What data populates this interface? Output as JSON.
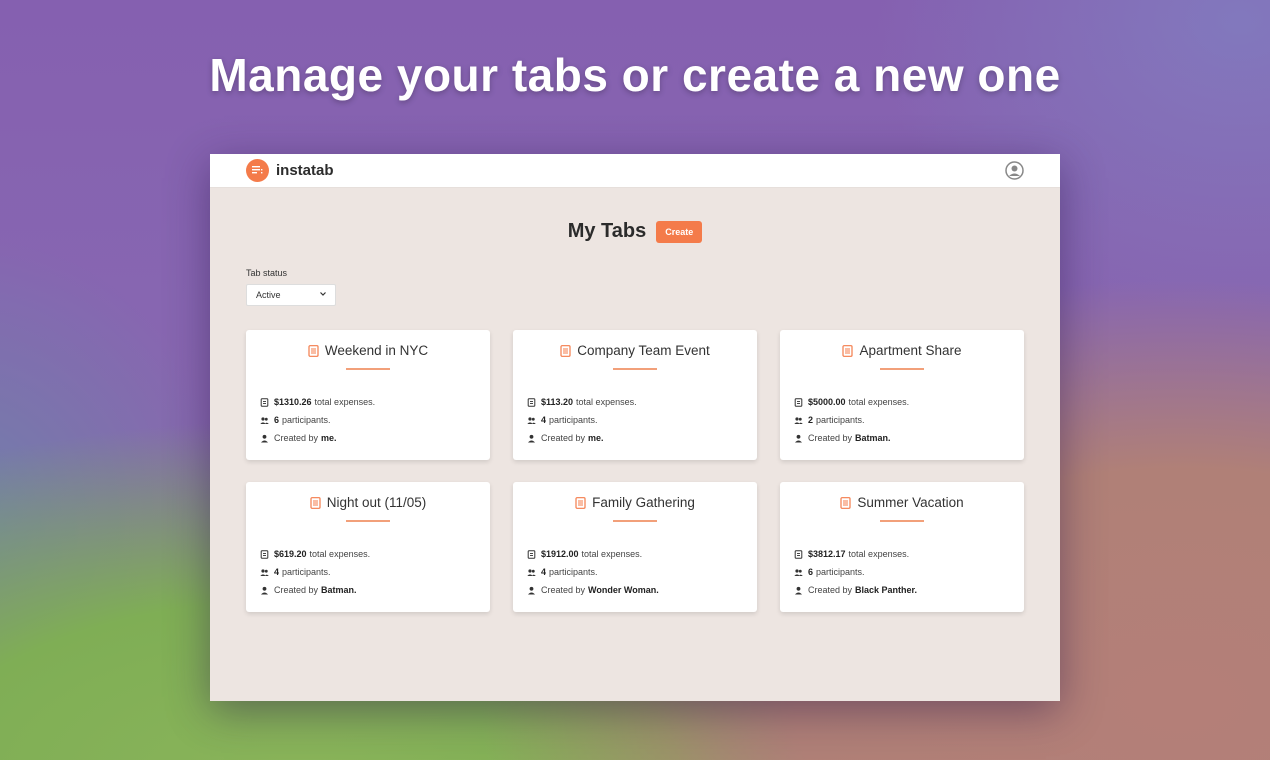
{
  "headline": "Manage your tabs or create a new one",
  "app": {
    "name": "instatab"
  },
  "page": {
    "title": "My Tabs",
    "create_label": "Create"
  },
  "filter": {
    "label": "Tab status",
    "selected": "Active"
  },
  "labels": {
    "expenses_suffix": "total expenses.",
    "participants_suffix": "participants.",
    "created_by_prefix": "Created by"
  },
  "colors": {
    "accent": "#f47b4a",
    "surface": "#ede5e1"
  },
  "tabs": [
    {
      "title": "Weekend in NYC",
      "total": "$1310.26",
      "participants": "6",
      "creator": "me."
    },
    {
      "title": "Company Team Event",
      "total": "$113.20",
      "participants": "4",
      "creator": "me."
    },
    {
      "title": "Apartment Share",
      "total": "$5000.00",
      "participants": "2",
      "creator": "Batman."
    },
    {
      "title": "Night out (11/05)",
      "total": "$619.20",
      "participants": "4",
      "creator": "Batman."
    },
    {
      "title": "Family Gathering",
      "total": "$1912.00",
      "participants": "4",
      "creator": "Wonder Woman."
    },
    {
      "title": "Summer Vacation",
      "total": "$3812.17",
      "participants": "6",
      "creator": "Black Panther."
    }
  ]
}
